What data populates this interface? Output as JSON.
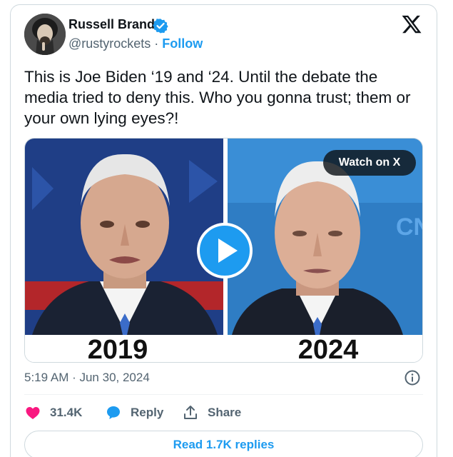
{
  "author": {
    "name": "Russell Brand",
    "handle": "@rustyrockets",
    "separator": " · ",
    "follow_label": "Follow"
  },
  "tweet": {
    "text": "This is Joe Biden ‘19 and ‘24. Until the debate the media tried to deny this. Who you gonna trust; them or your own lying eyes?!"
  },
  "media": {
    "left_year": "2019",
    "right_year": "2024",
    "watch_label": "Watch on X"
  },
  "meta": {
    "timestamp": "5:19 AM · Jun 30, 2024"
  },
  "actions": {
    "like_count": "31.4K",
    "reply_label": "Reply",
    "share_label": "Share"
  },
  "read_replies_label": "Read 1.7K replies",
  "colors": {
    "accent": "#1d9bf0",
    "like": "#f91880",
    "text_secondary": "#536471",
    "border": "#cfd9de"
  }
}
